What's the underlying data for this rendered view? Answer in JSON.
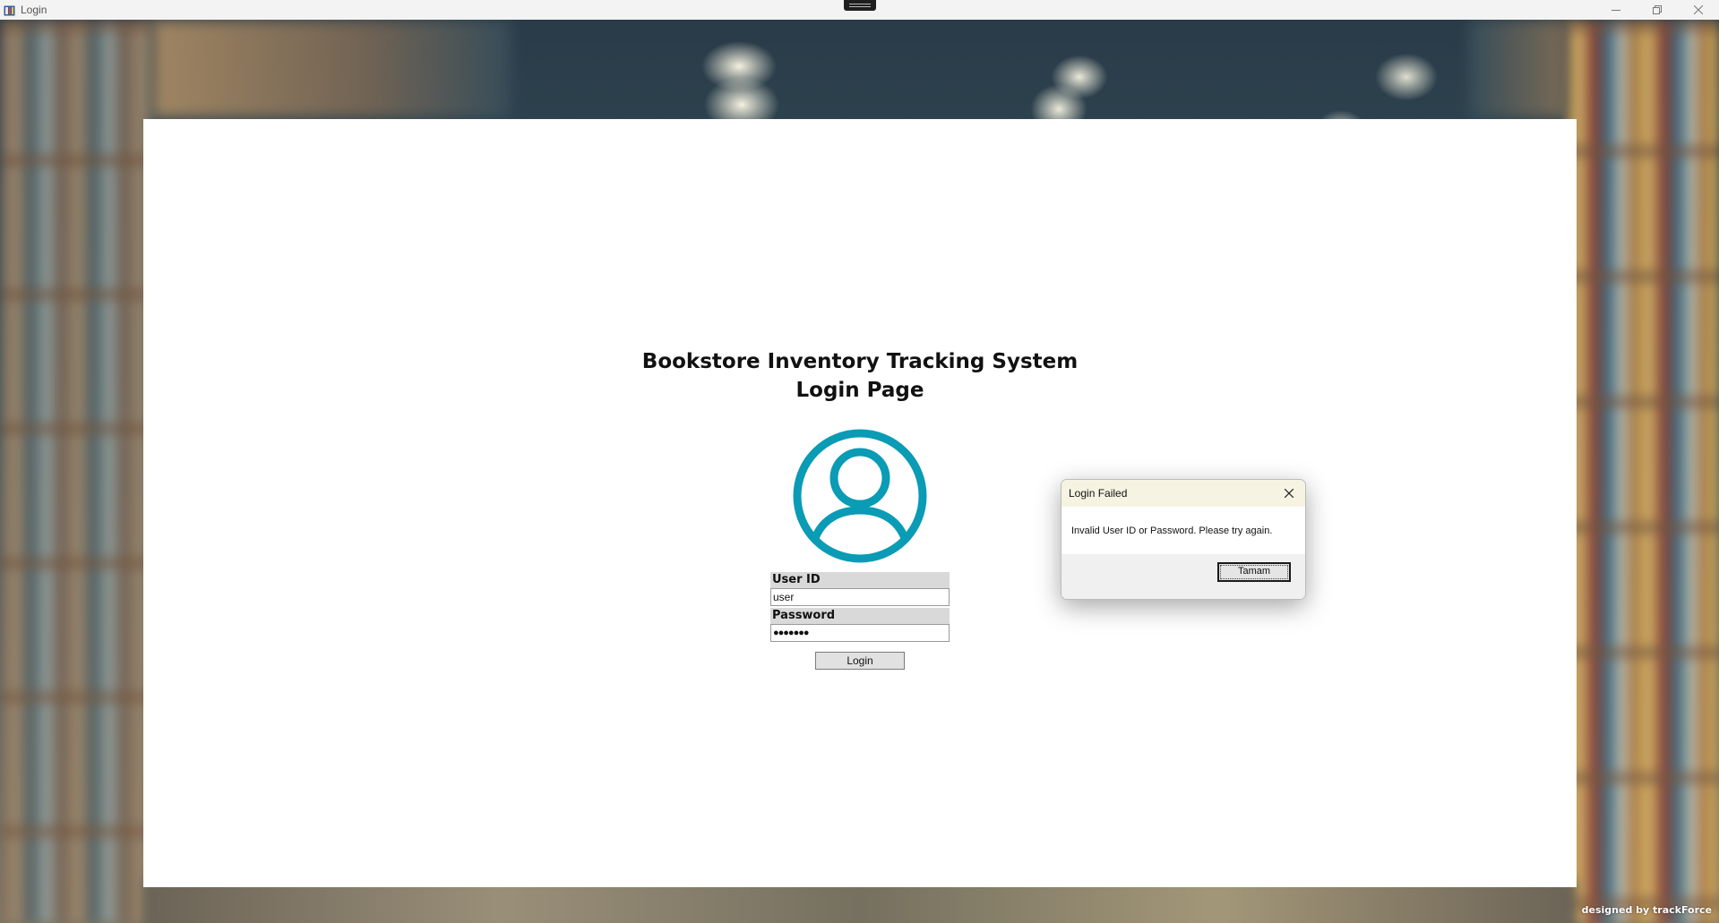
{
  "window": {
    "title": "Login",
    "controls": [
      "minimize",
      "restore",
      "close"
    ]
  },
  "page": {
    "heading_line1": "Bookstore Inventory Tracking System",
    "heading_line2": "Login Page",
    "avatar_icon": "user-circle-icon",
    "accent_color": "#0a9bb5"
  },
  "form": {
    "user_id_label": "User ID",
    "user_id_value": "user",
    "password_label": "Password",
    "password_value": "●●●●●●●",
    "login_label": "Login"
  },
  "dialog": {
    "title": "Login Failed",
    "message": "Invalid User ID or Password. Please try again.",
    "ok_label": "Tamam"
  },
  "footer": {
    "credit": "designed by trackForce"
  }
}
